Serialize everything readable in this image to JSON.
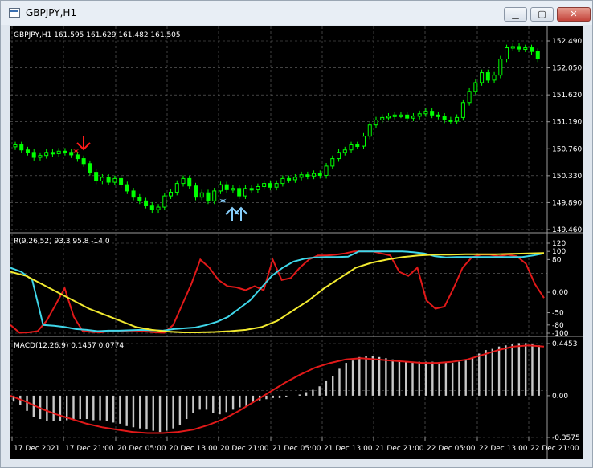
{
  "window": {
    "title": "GBPJPY,H1",
    "buttons": {
      "minimize": "▁",
      "maximize": "▢",
      "close": "✕"
    }
  },
  "main_panel": {
    "header": "GBPJPY,H1  161.595 161.629 161.482 161.505",
    "y_ticks": [
      "152.490",
      "152.050",
      "151.620",
      "151.190",
      "150.760",
      "150.330",
      "149.890",
      "149.460"
    ]
  },
  "rsi_panel": {
    "header": "R(9,26,52) 93.3 95.8 -14.0",
    "y_ticks": [
      "120",
      "100",
      "80",
      "0.00",
      "-50",
      "-80",
      "-100"
    ]
  },
  "macd_panel": {
    "header": "MACD(12,26,9) 0.1457 0.0774",
    "y_ticks": [
      "0.4453",
      "0.00",
      "-0.3575"
    ]
  },
  "time_axis": [
    "17 Dec 2021",
    "17 Dec 21:00",
    "20 Dec 05:00",
    "20 Dec 13:00",
    "20 Dec 21:00",
    "21 Dec 05:00",
    "21 Dec 13:00",
    "21 Dec 21:00",
    "22 Dec 05:00",
    "22 Dec 13:00",
    "22 Dec 21:00"
  ],
  "colors": {
    "background": "#000000",
    "grid": "#6a6a6a",
    "candle": "#00ff00",
    "sell_arrow": "#ff1a1a",
    "buy_arrow": "#87cefa",
    "rsi_fast": "#e11919",
    "rsi_mid": "#3fd7ea",
    "rsi_slow": "#f2ea30",
    "macd_hist": "#c8c8c8",
    "macd_signal": "#e11919",
    "text": "#ffffff"
  },
  "chart_data": [
    {
      "type": "candlestick",
      "title": "GBPJPY,H1",
      "ylim": [
        149.46,
        152.49
      ],
      "close": [
        150.82,
        150.74,
        150.7,
        150.62,
        150.65,
        150.7,
        150.68,
        150.72,
        150.7,
        150.66,
        150.6,
        150.52,
        150.38,
        150.24,
        150.3,
        150.22,
        150.28,
        150.18,
        150.08,
        149.98,
        149.92,
        149.85,
        149.78,
        149.82,
        150.0,
        150.06,
        150.2,
        150.28,
        150.16,
        149.98,
        150.05,
        149.92,
        150.08,
        150.18,
        150.1,
        150.12,
        150.0,
        150.12,
        150.1,
        150.15,
        150.2,
        150.14,
        150.2,
        150.28,
        150.26,
        150.3,
        150.34,
        150.32,
        150.36,
        150.33,
        150.48,
        150.6,
        150.7,
        150.74,
        150.82,
        150.8,
        150.96,
        151.14,
        151.22,
        151.26,
        151.28,
        151.3,
        151.3,
        151.25,
        151.28,
        151.32,
        151.36,
        151.3,
        151.28,
        151.22,
        151.2,
        151.26,
        151.5,
        151.68,
        151.82,
        151.98,
        151.86,
        151.94,
        152.2,
        152.38,
        152.4,
        152.36,
        152.38,
        152.32,
        152.2
      ]
    },
    {
      "type": "line",
      "title": "R(9,26,52)",
      "ylim": [
        -100,
        120
      ],
      "series": [
        {
          "values": [
            -80,
            -99,
            -98,
            -95,
            -70,
            -30,
            10,
            -60,
            -95,
            -97,
            -98,
            -95,
            -95,
            -94,
            -94,
            -96,
            -98,
            -99,
            -80,
            -30,
            20,
            80,
            60,
            30,
            15,
            12,
            5,
            15,
            5,
            80,
            30,
            35,
            60,
            80,
            90,
            90,
            92,
            95,
            100,
            100,
            100,
            95,
            90,
            50,
            40,
            60,
            -20,
            -40,
            -35,
            10,
            60,
            85,
            92,
            92,
            88,
            92,
            88,
            70,
            20,
            -14
          ]
        },
        {
          "values": [
            60,
            50,
            30,
            -80,
            -82,
            -85,
            -90,
            -92,
            -95,
            -94,
            -94,
            -93,
            -92,
            -93,
            -94,
            -90,
            -88,
            -86,
            -80,
            -72,
            -60,
            -40,
            -20,
            10,
            40,
            60,
            75,
            82,
            85,
            86,
            86,
            87,
            100,
            100,
            100,
            100,
            100,
            98,
            95,
            88,
            85,
            86,
            86,
            86,
            86,
            86,
            86,
            86,
            90,
            95
          ]
        },
        {
          "values": [
            50,
            40,
            20,
            0,
            -20,
            -40,
            -55,
            -70,
            -85,
            -92,
            -96,
            -98,
            -98,
            -97,
            -95,
            -92,
            -85,
            -70,
            -45,
            -20,
            10,
            35,
            60,
            72,
            80,
            86,
            90,
            92,
            92,
            93,
            93,
            93,
            94,
            95,
            96
          ]
        }
      ]
    },
    {
      "type": "bar",
      "title": "MACD(12,26,9)",
      "ylim": [
        -0.3575,
        0.4453
      ],
      "values": [
        -0.05,
        -0.08,
        -0.13,
        -0.18,
        -0.2,
        -0.22,
        -0.22,
        -0.22,
        -0.21,
        -0.2,
        -0.2,
        -0.2,
        -0.21,
        -0.21,
        -0.22,
        -0.23,
        -0.24,
        -0.26,
        -0.27,
        -0.28,
        -0.29,
        -0.3,
        -0.31,
        -0.3,
        -0.28,
        -0.25,
        -0.2,
        -0.15,
        -0.12,
        -0.12,
        -0.15,
        -0.16,
        -0.14,
        -0.12,
        -0.1,
        -0.09,
        -0.06,
        -0.04,
        -0.03,
        -0.02,
        -0.02,
        -0.01,
        0.0,
        0.01,
        0.03,
        0.05,
        0.08,
        0.13,
        0.17,
        0.23,
        0.28,
        0.3,
        0.33,
        0.34,
        0.34,
        0.33,
        0.32,
        0.31,
        0.3,
        0.29,
        0.29,
        0.29,
        0.29,
        0.29,
        0.28,
        0.28,
        0.28,
        0.29,
        0.3,
        0.32,
        0.36,
        0.39,
        0.4,
        0.42,
        0.43,
        0.44,
        0.45,
        0.45,
        0.44,
        0.43
      ],
      "signal": [
        0.0,
        -0.05,
        -0.11,
        -0.16,
        -0.2,
        -0.24,
        -0.27,
        -0.29,
        -0.31,
        -0.32,
        -0.32,
        -0.31,
        -0.29,
        -0.25,
        -0.2,
        -0.13,
        -0.05,
        0.03,
        0.11,
        0.18,
        0.24,
        0.28,
        0.31,
        0.32,
        0.31,
        0.3,
        0.29,
        0.28,
        0.28,
        0.29,
        0.31,
        0.35,
        0.39,
        0.42,
        0.43,
        0.42
      ]
    }
  ]
}
